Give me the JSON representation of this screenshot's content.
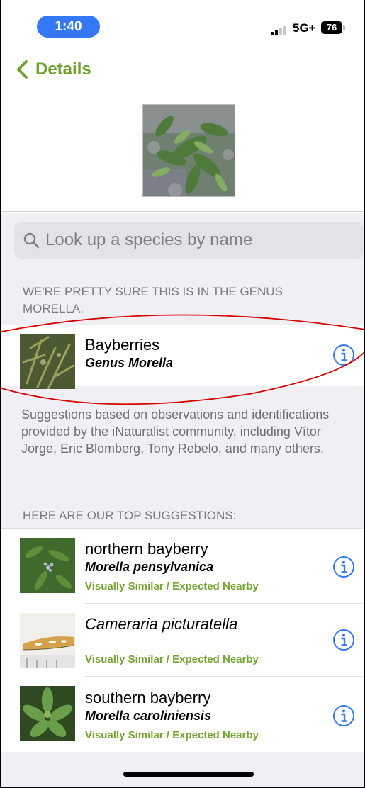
{
  "status_bar": {
    "time": "1:40",
    "network": "5G+",
    "battery": "76",
    "accent": "#3478f6"
  },
  "nav": {
    "back_label": "Details",
    "back_icon": "chevron-left-icon",
    "accent": "#6fa12e"
  },
  "photo": {
    "alt": "observation-photo"
  },
  "search": {
    "placeholder": "Look up a species by name",
    "icon": "search-icon"
  },
  "confident": {
    "header": "WE'RE PRETTY SURE THIS IS IN THE GENUS MORELLA.",
    "name": "Bayberries",
    "rank_name": "Genus Morella",
    "icon": "info-icon"
  },
  "note": "Suggestions based on observations and identifications provided by the iNaturalist community, including Vítor Jorge, Eric Blomberg, Tony Rebelo, and many others.",
  "suggestions_header": "HERE ARE OUR TOP SUGGESTIONS:",
  "suggestions": [
    {
      "common": "northern bayberry",
      "scientific": "Morella pensylvanica",
      "tag": "Visually Similar / Expected Nearby"
    },
    {
      "common": "",
      "scientific": "Cameraria picturatella",
      "tag": "Visually Similar / Expected Nearby"
    },
    {
      "common": "southern bayberry",
      "scientific": "Morella caroliniensis",
      "tag": "Visually Similar / Expected Nearby"
    }
  ],
  "colors": {
    "tag_green": "#74a432",
    "info_blue": "#3478f6",
    "highlight_red": "#d40000"
  }
}
